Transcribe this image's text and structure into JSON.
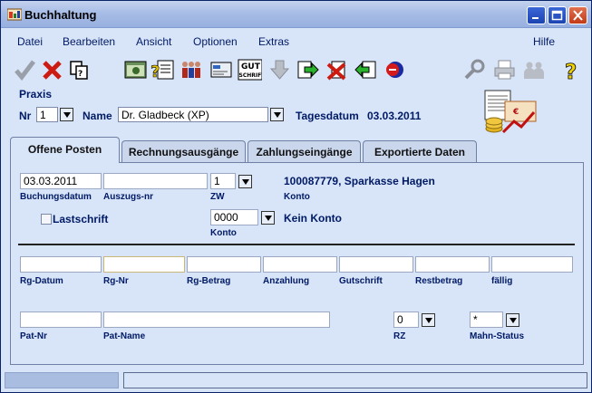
{
  "window": {
    "title": "Buchhaltung"
  },
  "menu": {
    "items": [
      {
        "label": "Datei"
      },
      {
        "label": "Bearbeiten"
      },
      {
        "label": "Ansicht"
      },
      {
        "label": "Optionen"
      },
      {
        "label": "Extras"
      },
      {
        "label": "Hilfe"
      }
    ]
  },
  "toolbar": {
    "icons": [
      "check-icon",
      "cancel-x-icon",
      "copy-pages-icon",
      "open-window-icon",
      "search-document-icon",
      "people-group-icon",
      "card-icon",
      "gutschrift-icon",
      "download-arrow-icon",
      "export-green-icon",
      "delete-red-x-icon",
      "import-arrow-icon",
      "stamp-icon",
      "key-search-icon",
      "printer-icon",
      "users-icon",
      "help-question-icon"
    ],
    "gutschrift_text": "GUT\nSCHRIFT"
  },
  "header": {
    "praxis_label": "Praxis",
    "nr_label": "Nr",
    "nr_value": "1",
    "name_label": "Name",
    "name_value": "Dr. Gladbeck (XP)",
    "tagesdatum_label": "Tagesdatum",
    "tagesdatum_value": "03.03.2011"
  },
  "tabs": [
    {
      "label": "Offene Posten",
      "active": true
    },
    {
      "label": "Rechnungsausgänge"
    },
    {
      "label": "Zahlungseingänge"
    },
    {
      "label": "Exportierte Daten"
    }
  ],
  "form": {
    "buchungsdatum_value": "03.03.2011",
    "buchungsdatum_label": "Buchungsdatum",
    "auszugs_nr_value": "",
    "auszugs_nr_label": "Auszugs-nr",
    "zw_value": "1",
    "zw_label": "ZW",
    "konto_info": "100087779, Sparkasse Hagen",
    "konto_info_label": "Konto",
    "lastschrift_label": "Lastschrift",
    "konto_value": "0000",
    "konto_label": "Konto",
    "kein_konto": "Kein Konto",
    "rg_datum_label": "Rg-Datum",
    "rg_nr_label": "Rg-Nr",
    "rg_betrag_label": "Rg-Betrag",
    "anzahlung_label": "Anzahlung",
    "gutschrift_label": "Gutschrift",
    "restbetrag_label": "Restbetrag",
    "faellig_label": "fällig",
    "pat_nr_label": "Pat-Nr",
    "pat_name_label": "Pat-Name",
    "rz_value": "0",
    "rz_label": "RZ",
    "mahn_status_value": "*",
    "mahn_status_label": "Mahn-Status"
  }
}
